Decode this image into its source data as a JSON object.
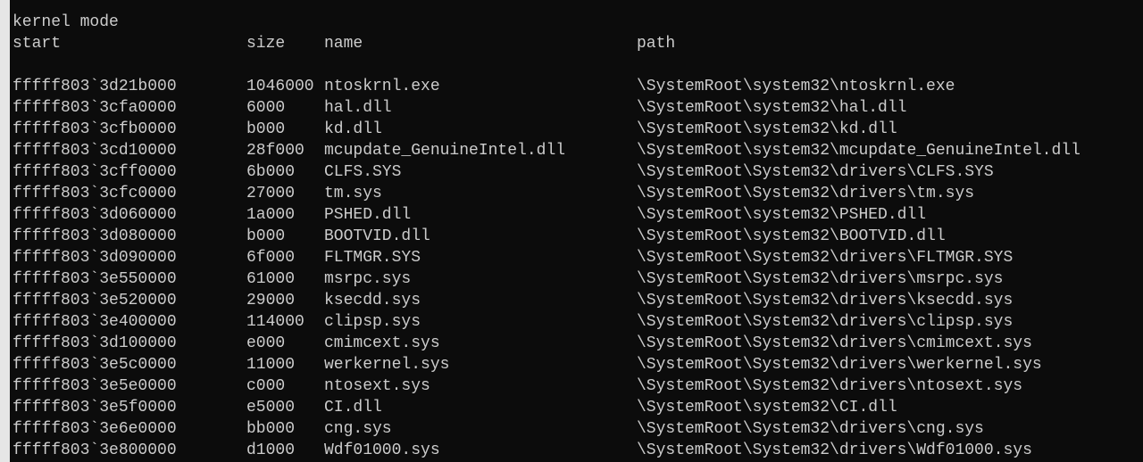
{
  "title": "kernel mode",
  "columns": [
    "start",
    "size",
    "name",
    "path"
  ],
  "rows": [
    [
      "fffff803`3d21b000",
      "1046000",
      "ntoskrnl.exe",
      "\\SystemRoot\\system32\\ntoskrnl.exe"
    ],
    [
      "fffff803`3cfa0000",
      "6000",
      "hal.dll",
      "\\SystemRoot\\system32\\hal.dll"
    ],
    [
      "fffff803`3cfb0000",
      "b000",
      "kd.dll",
      "\\SystemRoot\\system32\\kd.dll"
    ],
    [
      "fffff803`3cd10000",
      "28f000",
      "mcupdate_GenuineIntel.dll",
      "\\SystemRoot\\system32\\mcupdate_GenuineIntel.dll"
    ],
    [
      "fffff803`3cff0000",
      "6b000",
      "CLFS.SYS",
      "\\SystemRoot\\System32\\drivers\\CLFS.SYS"
    ],
    [
      "fffff803`3cfc0000",
      "27000",
      "tm.sys",
      "\\SystemRoot\\System32\\drivers\\tm.sys"
    ],
    [
      "fffff803`3d060000",
      "1a000",
      "PSHED.dll",
      "\\SystemRoot\\system32\\PSHED.dll"
    ],
    [
      "fffff803`3d080000",
      "b000",
      "BOOTVID.dll",
      "\\SystemRoot\\system32\\BOOTVID.dll"
    ],
    [
      "fffff803`3d090000",
      "6f000",
      "FLTMGR.SYS",
      "\\SystemRoot\\System32\\drivers\\FLTMGR.SYS"
    ],
    [
      "fffff803`3e550000",
      "61000",
      "msrpc.sys",
      "\\SystemRoot\\System32\\drivers\\msrpc.sys"
    ],
    [
      "fffff803`3e520000",
      "29000",
      "ksecdd.sys",
      "\\SystemRoot\\System32\\drivers\\ksecdd.sys"
    ],
    [
      "fffff803`3e400000",
      "114000",
      "clipsp.sys",
      "\\SystemRoot\\System32\\drivers\\clipsp.sys"
    ],
    [
      "fffff803`3d100000",
      "e000",
      "cmimcext.sys",
      "\\SystemRoot\\System32\\drivers\\cmimcext.sys"
    ],
    [
      "fffff803`3e5c0000",
      "11000",
      "werkernel.sys",
      "\\SystemRoot\\System32\\drivers\\werkernel.sys"
    ],
    [
      "fffff803`3e5e0000",
      "c000",
      "ntosext.sys",
      "\\SystemRoot\\System32\\drivers\\ntosext.sys"
    ],
    [
      "fffff803`3e5f0000",
      "e5000",
      "CI.dll",
      "\\SystemRoot\\system32\\CI.dll"
    ],
    [
      "fffff803`3e6e0000",
      "bb000",
      "cng.sys",
      "\\SystemRoot\\System32\\drivers\\cng.sys"
    ],
    [
      "fffff803`3e800000",
      "d1000",
      "Wdf01000.sys",
      "\\SystemRoot\\System32\\drivers\\Wdf01000.sys"
    ]
  ]
}
